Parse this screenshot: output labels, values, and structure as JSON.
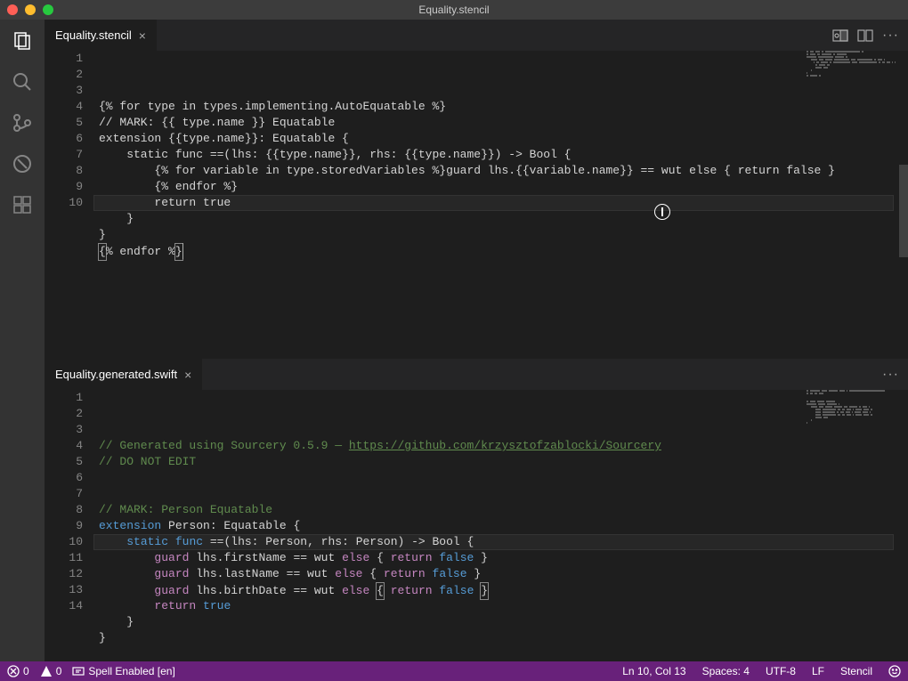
{
  "titlebar": {
    "title": "Equality.stencil"
  },
  "activity_bar": {
    "items": [
      "explorer-icon",
      "search-icon",
      "git-icon",
      "debug-icon",
      "extensions-icon"
    ]
  },
  "top_editor": {
    "tab_title": "Equality.stencil",
    "actions": [
      "split-side-icon",
      "split-icon",
      "more-icon"
    ],
    "lines": [
      "{% for type in types.implementing.AutoEquatable %}",
      "// MARK: {{ type.name }} Equatable",
      "extension {{type.name}}: Equatable {",
      "    static func ==(lhs: {{type.name}}, rhs: {{type.name}}) -> Bool {",
      "        {% for variable in type.storedVariables %}guard lhs.{{variable.name}} == wut else { return false }",
      "        {% endfor %}",
      "        return true",
      "    }",
      "}",
      "{% endfor %}"
    ],
    "highlighted_line": 10,
    "cursor_col": 13
  },
  "bottom_editor": {
    "tab_title": "Equality.generated.swift",
    "actions": [
      "more-icon"
    ],
    "generated_comment_prefix": "// Generated using Sourcery 0.5.9 — ",
    "generated_url": "https://github.com/krzysztofzablocki/Sourcery",
    "do_not_edit": "// DO NOT EDIT",
    "mark_comment": "// MARK: Person Equatable",
    "extension_decl": {
      "kw": "extension",
      "type": "Person",
      "protocol": "Equatable"
    },
    "func_decl": {
      "kw_static": "static",
      "kw_func": "func",
      "name": "==",
      "params": "(lhs: Person, rhs: Person)",
      "arrow": "->",
      "ret": "Bool"
    },
    "guards": [
      {
        "field": "firstName",
        "cmp": "wut"
      },
      {
        "field": "lastName",
        "cmp": "wut"
      },
      {
        "field": "birthDate",
        "cmp": "wut"
      }
    ],
    "return_kw": "return",
    "return_val": "true",
    "highlighted_line": 10,
    "line_count": 14
  },
  "status_bar": {
    "errors": "0",
    "warnings": "0",
    "spell": "Spell Enabled [en]",
    "line_col": "Ln 10, Col 13",
    "spaces": "Spaces: 4",
    "encoding": "UTF-8",
    "eol": "LF",
    "language": "Stencil"
  }
}
